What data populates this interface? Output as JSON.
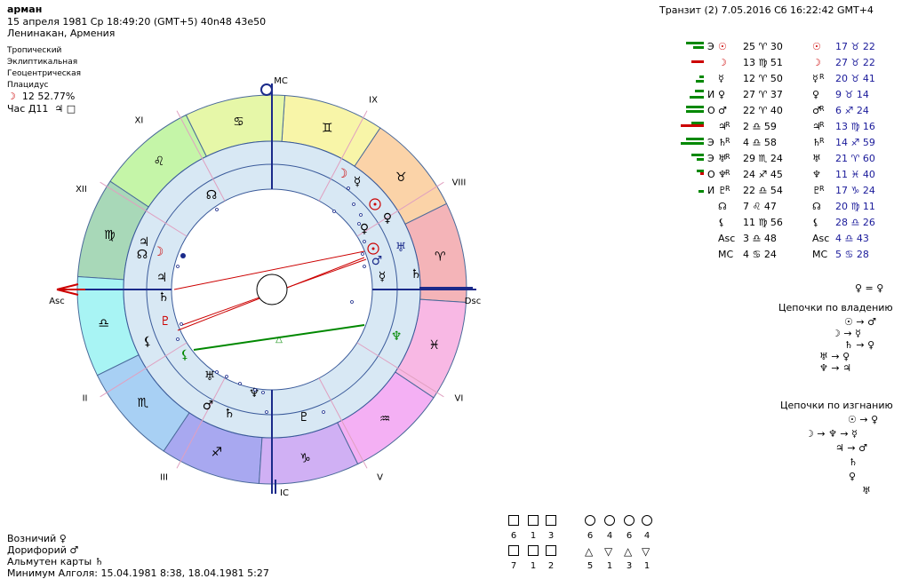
{
  "header": {
    "name": "арман",
    "date_line": "15 апреля 1981  Ср  18:49:20 (GMT+5) 40n48  43e50",
    "place": "Ленинакан, Армения",
    "transit": "Транзит (2)  7.05.2016  Сб 16:22:42 GMT+4"
  },
  "settings": {
    "zodiac": "Тропический",
    "coords": "Эклиптикальная",
    "center": "Геоцентрическая",
    "houses": "Плацидус",
    "moon_phase": "12 52.77%",
    "hour": "Час Д11"
  },
  "chart": {
    "angles": {
      "mc": "MC",
      "ic": "IC",
      "asc": "Asc",
      "dsc": "Dsc"
    },
    "houses": [
      "XI",
      "IX",
      "XII",
      "VIII",
      "II",
      "VI",
      "III",
      "V"
    ],
    "signs": [
      "♋",
      "♊",
      "♌",
      "♉",
      "♍",
      "♈",
      "♎",
      "♓",
      "♏",
      "♒",
      "♐",
      "♑"
    ],
    "colors": {
      "aries": "#f4b4b8",
      "taurus": "#fbd3a8",
      "gemini": "#f8f5a8",
      "cancer": "#e6f7a8",
      "leo": "#c5f5a8",
      "virgo": "#a8d8b8",
      "libra": "#a8f4f4",
      "scorpio": "#a8d0f4",
      "sagittarius": "#a8a8f0",
      "capricorn": "#d0b0f4",
      "aquarius": "#f4b0f4",
      "pisces": "#f8b8e4",
      "ring": "#d8e8f4",
      "transit_line_red": "#c00",
      "transit_line_green": "#080"
    }
  },
  "planets": [
    {
      "glyph": "☉",
      "natal": "25 ♈ 30",
      "transit": "17 ♉ 22",
      "dig": "Э"
    },
    {
      "glyph": "☽",
      "natal": "13 ♍ 51",
      "transit": "27 ♉ 22",
      "dig": ""
    },
    {
      "glyph": "☿",
      "natal": "12 ♈ 50",
      "transit": "20 ♉ 41",
      "dig": "",
      "tr": "R"
    },
    {
      "glyph": "♀",
      "natal": "27 ♈ 37",
      "transit": "9 ♉ 14",
      "dig": "И"
    },
    {
      "glyph": "♂",
      "natal": "22 ♈ 40",
      "transit": "6 ♐ 24",
      "dig": "О",
      "tr": "R"
    },
    {
      "glyph": "♃",
      "natal": "2 ♎ 59",
      "transit": "13 ♍ 16",
      "dig": "",
      "nr": "R",
      "tr": "R"
    },
    {
      "glyph": "♄",
      "natal": "4 ♎ 58",
      "transit": "14 ♐ 59",
      "dig": "Э",
      "nr": "R",
      "tr": "R"
    },
    {
      "glyph": "♅",
      "natal": "29 ♏ 24",
      "transit": "21 ♈ 60",
      "dig": "Э",
      "nr": "R"
    },
    {
      "glyph": "♆",
      "natal": "24 ♐ 45",
      "transit": "11 ♓ 40",
      "dig": "О",
      "nr": "R"
    },
    {
      "glyph": "♇",
      "natal": "22 ♎ 54",
      "transit": "17 ♑ 24",
      "dig": "И",
      "nr": "R",
      "tr": "R"
    },
    {
      "glyph": "☊",
      "natal": "7 ♌ 47",
      "transit": "20 ♍ 11",
      "dig": ""
    },
    {
      "glyph": "⚸",
      "natal": "11 ♍ 56",
      "transit": "28 ♎ 26",
      "dig": ""
    },
    {
      "glyph": "Asc",
      "natal": "3 ♎ 48",
      "transit": "4 ♎ 43",
      "dig": ""
    },
    {
      "glyph": "MC",
      "natal": "4 ♋ 24",
      "transit": "5 ♋ 28",
      "dig": ""
    }
  ],
  "chains": {
    "equal": "♀ = ♀",
    "rulership_title": "Цепочки по владению",
    "rulership": [
      "☉ → ♂",
      "☽ → ☿",
      "♄ → ♀",
      "♅ → ♀",
      "♆ → ♃"
    ],
    "exile_title": "Цепочки по изгнанию",
    "exile": [
      "☉ → ♀",
      "☽ → ♆ → ☿",
      "♃ → ♂",
      "♄",
      "♀",
      "♅"
    ]
  },
  "footer": {
    "charioteer": "Возничий  ♀",
    "doryphory": "Дорифорий  ♂",
    "almuten": "Альмутен карты  ♄",
    "algol": "Минимум Алголя: 15.04.1981  8:38,  18.04.1981  5:27"
  },
  "modality": {
    "row1_nums": [
      "6",
      "1",
      "3",
      "6",
      "4",
      "6",
      "4"
    ],
    "row2_nums": [
      "7",
      "1",
      "2",
      "5",
      "1",
      "3",
      "1"
    ]
  }
}
